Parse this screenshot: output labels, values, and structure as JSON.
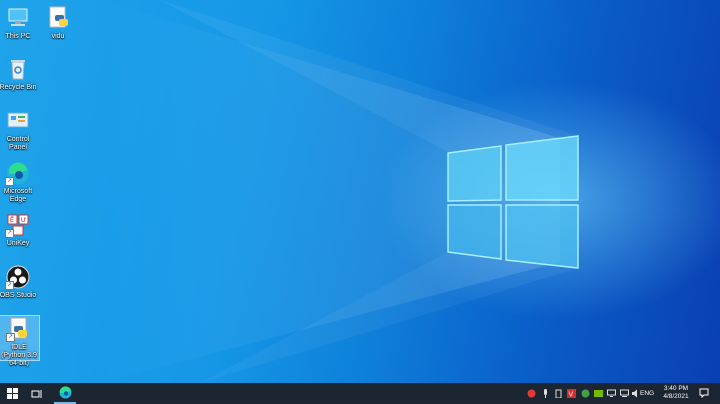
{
  "desktop_icons": [
    {
      "name": "this-pc",
      "label": "This PC"
    },
    {
      "name": "vidu",
      "label": "vidu"
    },
    {
      "name": "recycle-bin",
      "label": "Recycle Bin"
    },
    {
      "name": "control-panel",
      "label": "Control Panel"
    },
    {
      "name": "microsoft-edge",
      "label": "Microsoft Edge"
    },
    {
      "name": "unikey",
      "label": "UniKey"
    },
    {
      "name": "obs-studio",
      "label": "OBS Studio"
    },
    {
      "name": "idle-python",
      "label": "IDLE (Python 3.9 64-bit)"
    }
  ],
  "taskbar": {
    "start_icon": "windows-logo-icon",
    "task_view_icon": "task-view-icon",
    "pinned": [
      "edge-icon"
    ],
    "tray": {
      "language": "ENG",
      "time": "3:40 PM",
      "date": "4/8/2021"
    }
  },
  "colors": {
    "taskbar": "#1c2532",
    "wallpaper_left": "#1fa4ea",
    "wallpaper_right": "#0a3fb2",
    "logo_glow": "#7fe3ff"
  }
}
